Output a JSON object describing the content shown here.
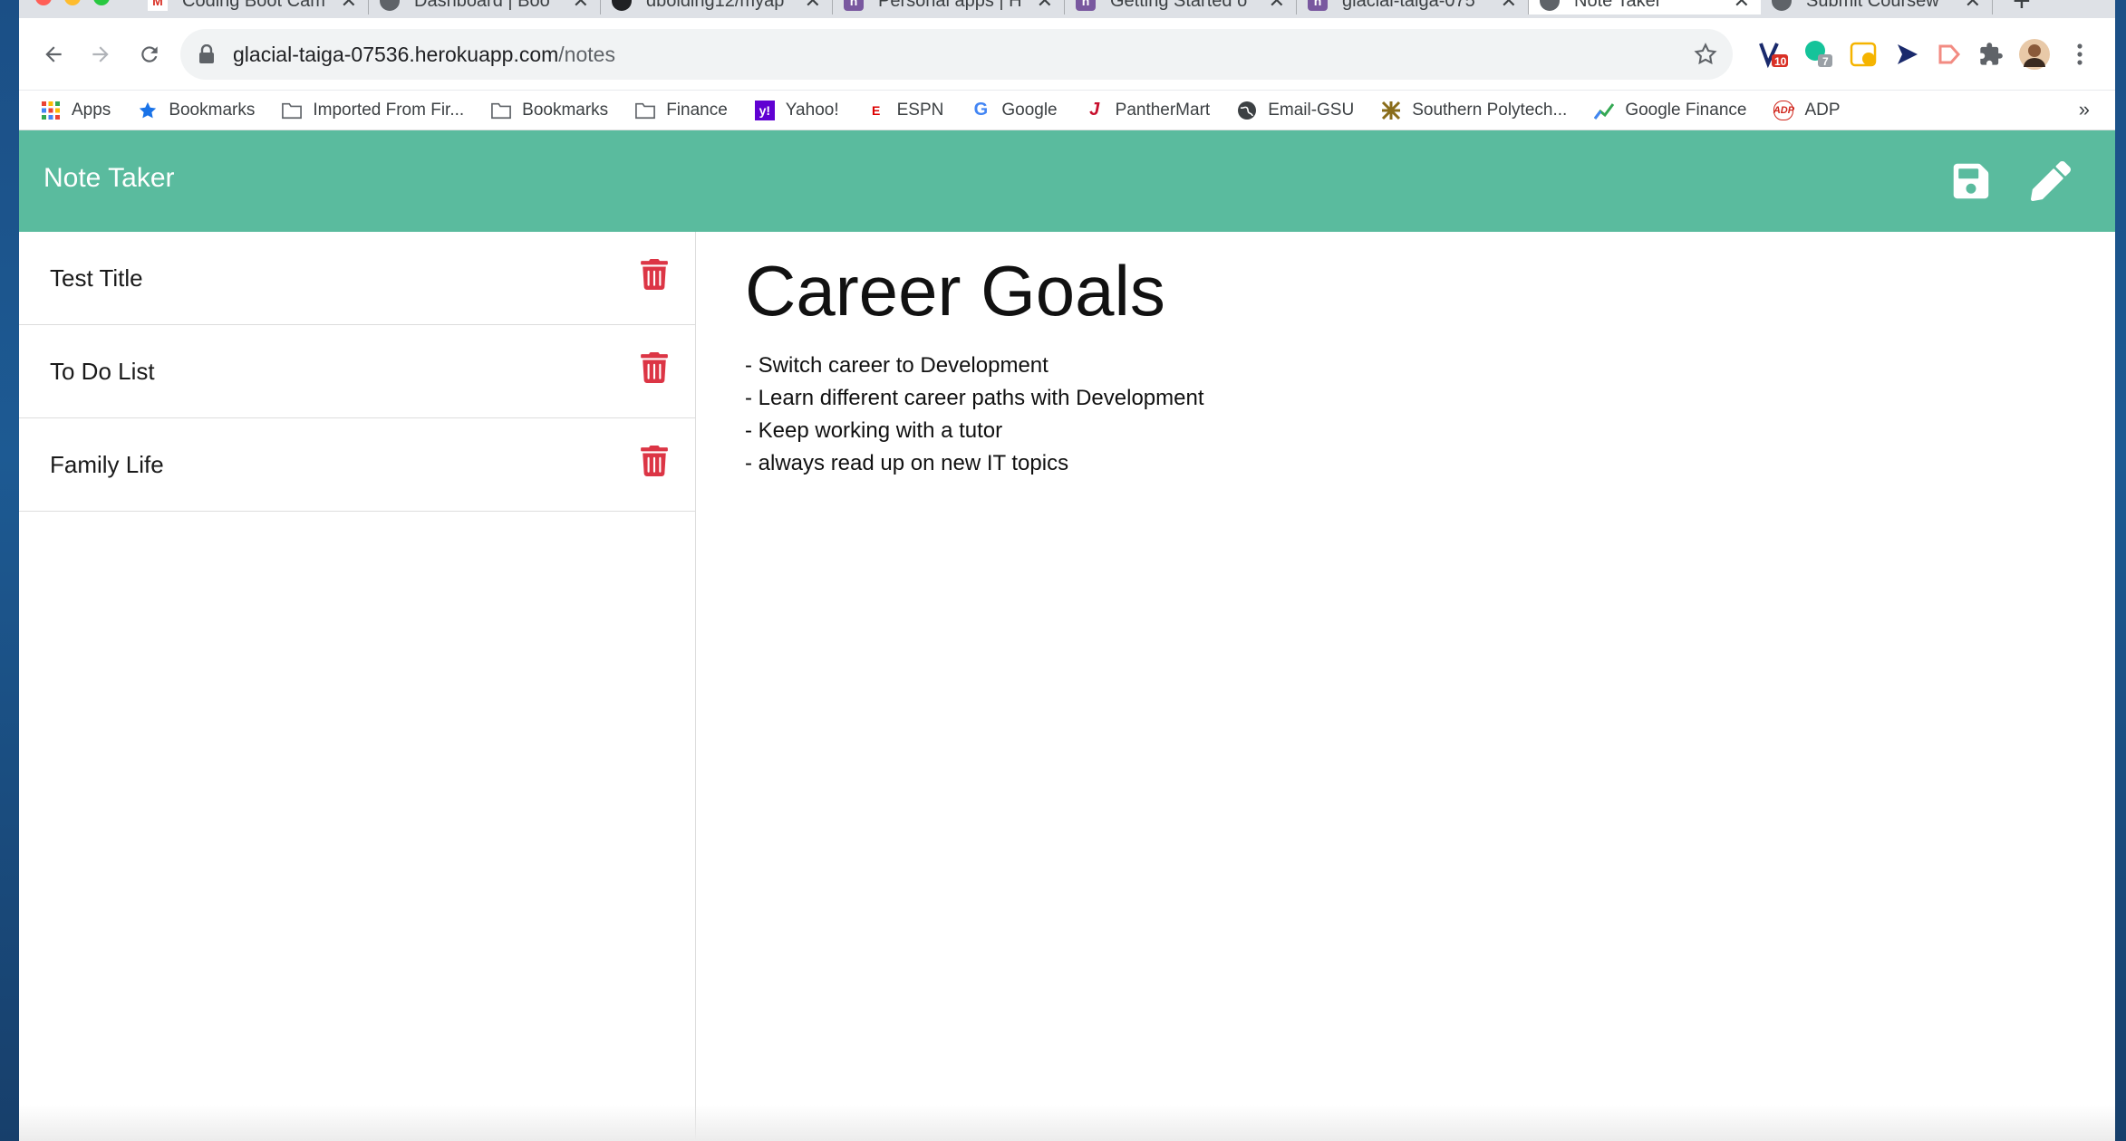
{
  "browser": {
    "tabs": [
      {
        "title": "Coding Boot Cam",
        "icon": "gmail-icon",
        "color": "#d93025"
      },
      {
        "title": "Dashboard | Boo",
        "icon": "globe-icon",
        "color": "#5f6368"
      },
      {
        "title": "dbolding12/myap",
        "icon": "github-icon",
        "color": "#202124"
      },
      {
        "title": "Personal apps | H",
        "icon": "heroku-icon",
        "color": "#79589f"
      },
      {
        "title": "Getting Started o",
        "icon": "heroku-icon",
        "color": "#79589f"
      },
      {
        "title": "glacial-taiga-075",
        "icon": "heroku-icon",
        "color": "#79589f"
      },
      {
        "title": "Note Taker",
        "icon": "globe-icon",
        "color": "#5f6368",
        "active": true
      },
      {
        "title": "Submit Coursew",
        "icon": "globe-icon",
        "color": "#5f6368"
      }
    ],
    "url_host": "glacial-taiga-07536.herokuapp.com",
    "url_path": "/notes",
    "extension_badges": {
      "first": "10",
      "second": "7"
    },
    "bookmarks": [
      {
        "label": "Apps",
        "icon": "apps-grid-icon"
      },
      {
        "label": "Bookmarks",
        "icon": "star-icon"
      },
      {
        "label": "Imported From Fir...",
        "icon": "folder-icon"
      },
      {
        "label": "Bookmarks",
        "icon": "folder-icon"
      },
      {
        "label": "Finance",
        "icon": "folder-icon"
      },
      {
        "label": "Yahoo!",
        "icon": "yahoo-icon"
      },
      {
        "label": "ESPN",
        "icon": "espn-icon"
      },
      {
        "label": "Google",
        "icon": "google-icon"
      },
      {
        "label": "PantherMart",
        "icon": "panthermart-icon"
      },
      {
        "label": "Email-GSU",
        "icon": "globe-icon"
      },
      {
        "label": "Southern Polytech...",
        "icon": "polytech-icon"
      },
      {
        "label": "Google Finance",
        "icon": "google-finance-icon"
      },
      {
        "label": "ADP",
        "icon": "adp-icon"
      }
    ],
    "bookmarks_more": "»"
  },
  "app": {
    "title": "Note Taker",
    "colors": {
      "navbar": "#5abb9e",
      "trash": "#dc3545"
    },
    "notes": [
      {
        "title": "Test Title"
      },
      {
        "title": "To Do List"
      },
      {
        "title": "Family Life"
      }
    ],
    "active_note": {
      "title": "Career Goals",
      "body": "- Switch career to Development\n- Learn different career paths with Development\n- Keep working with a tutor\n- always read up on new IT topics"
    }
  }
}
